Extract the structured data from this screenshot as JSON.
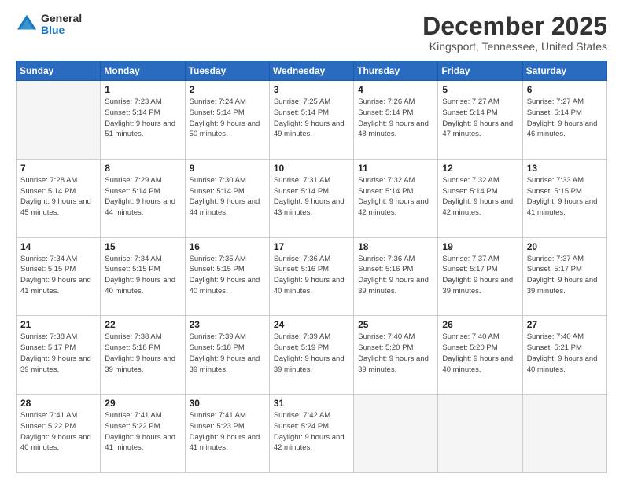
{
  "header": {
    "logo_general": "General",
    "logo_blue": "Blue",
    "month_title": "December 2025",
    "location": "Kingsport, Tennessee, United States"
  },
  "weekdays": [
    "Sunday",
    "Monday",
    "Tuesday",
    "Wednesday",
    "Thursday",
    "Friday",
    "Saturday"
  ],
  "weeks": [
    [
      {
        "day": "",
        "sunrise": "",
        "sunset": "",
        "daylight": ""
      },
      {
        "day": "1",
        "sunrise": "Sunrise: 7:23 AM",
        "sunset": "Sunset: 5:14 PM",
        "daylight": "Daylight: 9 hours and 51 minutes."
      },
      {
        "day": "2",
        "sunrise": "Sunrise: 7:24 AM",
        "sunset": "Sunset: 5:14 PM",
        "daylight": "Daylight: 9 hours and 50 minutes."
      },
      {
        "day": "3",
        "sunrise": "Sunrise: 7:25 AM",
        "sunset": "Sunset: 5:14 PM",
        "daylight": "Daylight: 9 hours and 49 minutes."
      },
      {
        "day": "4",
        "sunrise": "Sunrise: 7:26 AM",
        "sunset": "Sunset: 5:14 PM",
        "daylight": "Daylight: 9 hours and 48 minutes."
      },
      {
        "day": "5",
        "sunrise": "Sunrise: 7:27 AM",
        "sunset": "Sunset: 5:14 PM",
        "daylight": "Daylight: 9 hours and 47 minutes."
      },
      {
        "day": "6",
        "sunrise": "Sunrise: 7:27 AM",
        "sunset": "Sunset: 5:14 PM",
        "daylight": "Daylight: 9 hours and 46 minutes."
      }
    ],
    [
      {
        "day": "7",
        "sunrise": "Sunrise: 7:28 AM",
        "sunset": "Sunset: 5:14 PM",
        "daylight": "Daylight: 9 hours and 45 minutes."
      },
      {
        "day": "8",
        "sunrise": "Sunrise: 7:29 AM",
        "sunset": "Sunset: 5:14 PM",
        "daylight": "Daylight: 9 hours and 44 minutes."
      },
      {
        "day": "9",
        "sunrise": "Sunrise: 7:30 AM",
        "sunset": "Sunset: 5:14 PM",
        "daylight": "Daylight: 9 hours and 44 minutes."
      },
      {
        "day": "10",
        "sunrise": "Sunrise: 7:31 AM",
        "sunset": "Sunset: 5:14 PM",
        "daylight": "Daylight: 9 hours and 43 minutes."
      },
      {
        "day": "11",
        "sunrise": "Sunrise: 7:32 AM",
        "sunset": "Sunset: 5:14 PM",
        "daylight": "Daylight: 9 hours and 42 minutes."
      },
      {
        "day": "12",
        "sunrise": "Sunrise: 7:32 AM",
        "sunset": "Sunset: 5:14 PM",
        "daylight": "Daylight: 9 hours and 42 minutes."
      },
      {
        "day": "13",
        "sunrise": "Sunrise: 7:33 AM",
        "sunset": "Sunset: 5:15 PM",
        "daylight": "Daylight: 9 hours and 41 minutes."
      }
    ],
    [
      {
        "day": "14",
        "sunrise": "Sunrise: 7:34 AM",
        "sunset": "Sunset: 5:15 PM",
        "daylight": "Daylight: 9 hours and 41 minutes."
      },
      {
        "day": "15",
        "sunrise": "Sunrise: 7:34 AM",
        "sunset": "Sunset: 5:15 PM",
        "daylight": "Daylight: 9 hours and 40 minutes."
      },
      {
        "day": "16",
        "sunrise": "Sunrise: 7:35 AM",
        "sunset": "Sunset: 5:15 PM",
        "daylight": "Daylight: 9 hours and 40 minutes."
      },
      {
        "day": "17",
        "sunrise": "Sunrise: 7:36 AM",
        "sunset": "Sunset: 5:16 PM",
        "daylight": "Daylight: 9 hours and 40 minutes."
      },
      {
        "day": "18",
        "sunrise": "Sunrise: 7:36 AM",
        "sunset": "Sunset: 5:16 PM",
        "daylight": "Daylight: 9 hours and 39 minutes."
      },
      {
        "day": "19",
        "sunrise": "Sunrise: 7:37 AM",
        "sunset": "Sunset: 5:17 PM",
        "daylight": "Daylight: 9 hours and 39 minutes."
      },
      {
        "day": "20",
        "sunrise": "Sunrise: 7:37 AM",
        "sunset": "Sunset: 5:17 PM",
        "daylight": "Daylight: 9 hours and 39 minutes."
      }
    ],
    [
      {
        "day": "21",
        "sunrise": "Sunrise: 7:38 AM",
        "sunset": "Sunset: 5:17 PM",
        "daylight": "Daylight: 9 hours and 39 minutes."
      },
      {
        "day": "22",
        "sunrise": "Sunrise: 7:38 AM",
        "sunset": "Sunset: 5:18 PM",
        "daylight": "Daylight: 9 hours and 39 minutes."
      },
      {
        "day": "23",
        "sunrise": "Sunrise: 7:39 AM",
        "sunset": "Sunset: 5:18 PM",
        "daylight": "Daylight: 9 hours and 39 minutes."
      },
      {
        "day": "24",
        "sunrise": "Sunrise: 7:39 AM",
        "sunset": "Sunset: 5:19 PM",
        "daylight": "Daylight: 9 hours and 39 minutes."
      },
      {
        "day": "25",
        "sunrise": "Sunrise: 7:40 AM",
        "sunset": "Sunset: 5:20 PM",
        "daylight": "Daylight: 9 hours and 39 minutes."
      },
      {
        "day": "26",
        "sunrise": "Sunrise: 7:40 AM",
        "sunset": "Sunset: 5:20 PM",
        "daylight": "Daylight: 9 hours and 40 minutes."
      },
      {
        "day": "27",
        "sunrise": "Sunrise: 7:40 AM",
        "sunset": "Sunset: 5:21 PM",
        "daylight": "Daylight: 9 hours and 40 minutes."
      }
    ],
    [
      {
        "day": "28",
        "sunrise": "Sunrise: 7:41 AM",
        "sunset": "Sunset: 5:22 PM",
        "daylight": "Daylight: 9 hours and 40 minutes."
      },
      {
        "day": "29",
        "sunrise": "Sunrise: 7:41 AM",
        "sunset": "Sunset: 5:22 PM",
        "daylight": "Daylight: 9 hours and 41 minutes."
      },
      {
        "day": "30",
        "sunrise": "Sunrise: 7:41 AM",
        "sunset": "Sunset: 5:23 PM",
        "daylight": "Daylight: 9 hours and 41 minutes."
      },
      {
        "day": "31",
        "sunrise": "Sunrise: 7:42 AM",
        "sunset": "Sunset: 5:24 PM",
        "daylight": "Daylight: 9 hours and 42 minutes."
      },
      {
        "day": "",
        "sunrise": "",
        "sunset": "",
        "daylight": ""
      },
      {
        "day": "",
        "sunrise": "",
        "sunset": "",
        "daylight": ""
      },
      {
        "day": "",
        "sunrise": "",
        "sunset": "",
        "daylight": ""
      }
    ]
  ]
}
